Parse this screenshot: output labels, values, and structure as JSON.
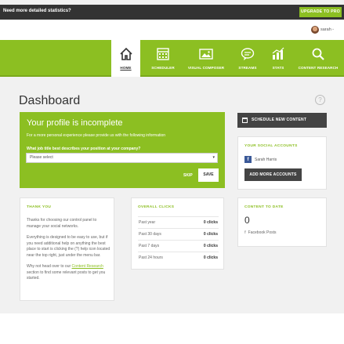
{
  "promo": {
    "text": "Need more detailed statistics?",
    "upgrade_label": "UPGRADE TO PRO"
  },
  "user": {
    "name": "sarah"
  },
  "nav": {
    "items": [
      {
        "label": "HOME",
        "icon": "home-icon",
        "active": true
      },
      {
        "label": "SCHEDULER",
        "icon": "calendar-icon",
        "active": false
      },
      {
        "label": "VISUAL COMPOSER",
        "icon": "image-icon",
        "active": false
      },
      {
        "label": "STREAMS",
        "icon": "chat-bubble-icon",
        "active": false
      },
      {
        "label": "STATS",
        "icon": "bar-chart-icon",
        "active": false
      },
      {
        "label": "CONTENT RESEARCH",
        "icon": "search-icon",
        "active": false
      }
    ]
  },
  "page": {
    "title": "Dashboard",
    "help": "?"
  },
  "profile": {
    "title": "Your profile is incomplete",
    "description": "For a more personal experience please provide us with the following information",
    "question": "What job title best describes your position at your company?",
    "select_value": "Please select",
    "skip_label": "SKIP",
    "save_label": "SAVE"
  },
  "schedule": {
    "label": "SCHEDULE NEW CONTENT"
  },
  "social": {
    "heading": "YOUR SOCIAL ACCOUNTS",
    "accounts": [
      {
        "name": "Sarah Harris",
        "network": "f"
      }
    ],
    "add_label": "ADD MORE ACCOUNTS"
  },
  "thanks": {
    "heading": "THANK YOU",
    "p1": "Thanks for choosing our control panel to manage your social networks.",
    "p2": "Everything is designed to be easy to use, but if you need additional help on anything the best place to start is clicking the (?) help icon located near the top right, just under the menu bar.",
    "p3_before": "Why not head over to our ",
    "p3_link": "Content Research",
    "p3_after": " section to find some relevant posts to get you started."
  },
  "clicks": {
    "heading": "OVERALL CLICKS",
    "rows": [
      {
        "label": "Past year",
        "value": "0 clicks"
      },
      {
        "label": "Past 30 days",
        "value": "0 clicks"
      },
      {
        "label": "Past 7 days",
        "value": "0 clicks"
      },
      {
        "label": "Past 24 hours",
        "value": "0 clicks"
      }
    ]
  },
  "content_to_date": {
    "heading": "CONTENT TO DATE",
    "count": "0",
    "fb_icon": "f",
    "fb_label": "Facebook Posts"
  },
  "colors": {
    "brand_green": "#8cbf22",
    "dark": "#444444",
    "facebook": "#3b5998"
  }
}
